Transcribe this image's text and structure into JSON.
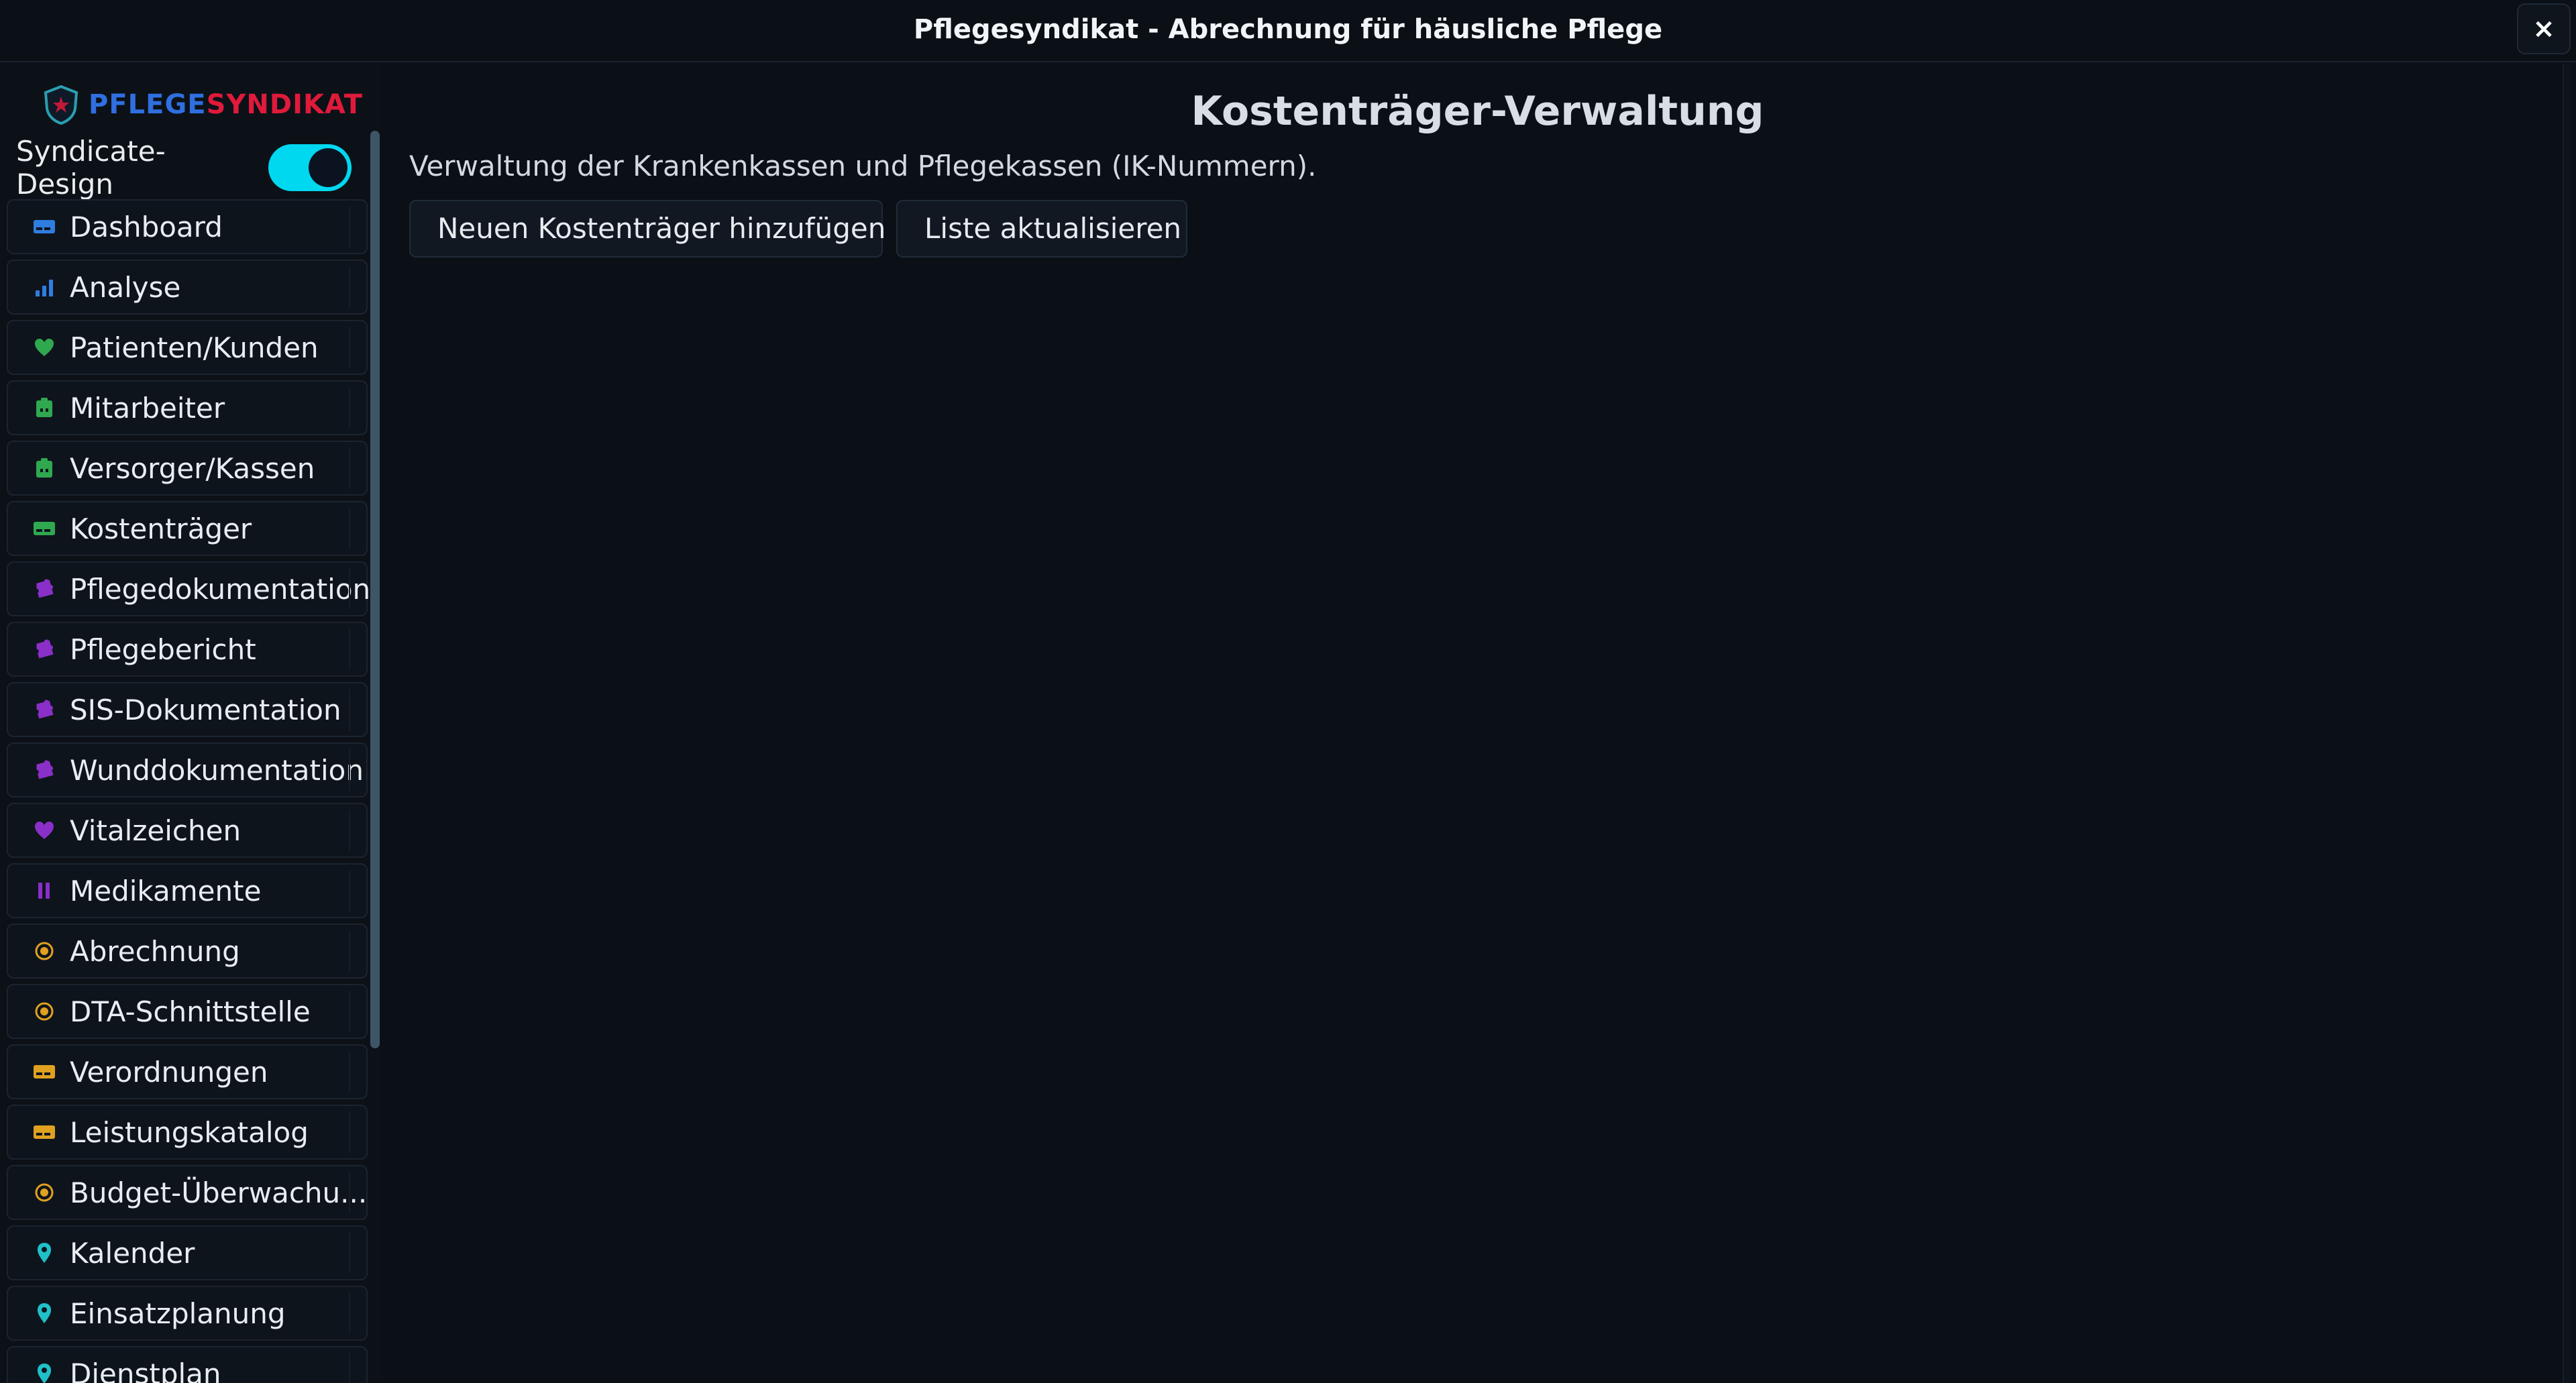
{
  "window": {
    "title": "Pflegesyndikat - Abrechnung für häusliche Pflege",
    "close_label": "×"
  },
  "sidebar": {
    "brand_part1": "PFLEGE",
    "brand_part2": "SYNDIKAT",
    "theme_toggle_label": "Syndicate-Design",
    "theme_toggle_on": true,
    "items": [
      {
        "label": "Dashboard",
        "icon": "card-icon",
        "color": "#2f7de0"
      },
      {
        "label": "Analyse",
        "icon": "bar-chart-icon",
        "color": "#2f7de0"
      },
      {
        "label": "Patienten/Kunden",
        "icon": "heart-icon",
        "color": "#2fa84f"
      },
      {
        "label": "Mitarbeiter",
        "icon": "badge-icon",
        "color": "#2fa84f"
      },
      {
        "label": "Versorger/Kassen",
        "icon": "badge-icon",
        "color": "#2fa84f"
      },
      {
        "label": "Kostenträger",
        "icon": "card-icon",
        "color": "#2fa84f"
      },
      {
        "label": "Pflegedokumentation",
        "icon": "puzzle-icon",
        "color": "#8a2fc8"
      },
      {
        "label": "Pflegebericht",
        "icon": "puzzle-icon",
        "color": "#8a2fc8"
      },
      {
        "label": "SIS-Dokumentation",
        "icon": "puzzle-icon",
        "color": "#8a2fc8"
      },
      {
        "label": "Wunddokumentation",
        "icon": "puzzle-icon",
        "color": "#8a2fc8"
      },
      {
        "label": "Vitalzeichen",
        "icon": "heart-icon",
        "color": "#8a2fc8"
      },
      {
        "label": "Medikamente",
        "icon": "pause-icon",
        "color": "#8a2fc8"
      },
      {
        "label": "Abrechnung",
        "icon": "coin-icon",
        "color": "#e0a020"
      },
      {
        "label": "DTA-Schnittstelle",
        "icon": "coin-icon",
        "color": "#e0a020"
      },
      {
        "label": "Verordnungen",
        "icon": "card-icon",
        "color": "#e0a020"
      },
      {
        "label": "Leistungskatalog",
        "icon": "card-icon",
        "color": "#e0a020"
      },
      {
        "label": "Budget-Überwachu...",
        "icon": "coin-icon",
        "color": "#e0a020"
      },
      {
        "label": "Kalender",
        "icon": "pin-icon",
        "color": "#20c0c8"
      },
      {
        "label": "Einsatzplanung",
        "icon": "pin-icon",
        "color": "#20c0c8"
      },
      {
        "label": "Dienstplan",
        "icon": "pin-icon",
        "color": "#20c0c8"
      }
    ]
  },
  "main": {
    "title": "Kostenträger-Verwaltung",
    "description": "Verwaltung der Krankenkassen und Pflegekassen (IK-Nummern).",
    "add_button": "Neuen Kostenträger hinzufügen",
    "refresh_button": "Liste aktualisieren"
  },
  "colors": {
    "background": "#0b0f16",
    "accent": "#00d8f0",
    "brand_blue": "#2f6fe0",
    "brand_red": "#e01a3a"
  }
}
